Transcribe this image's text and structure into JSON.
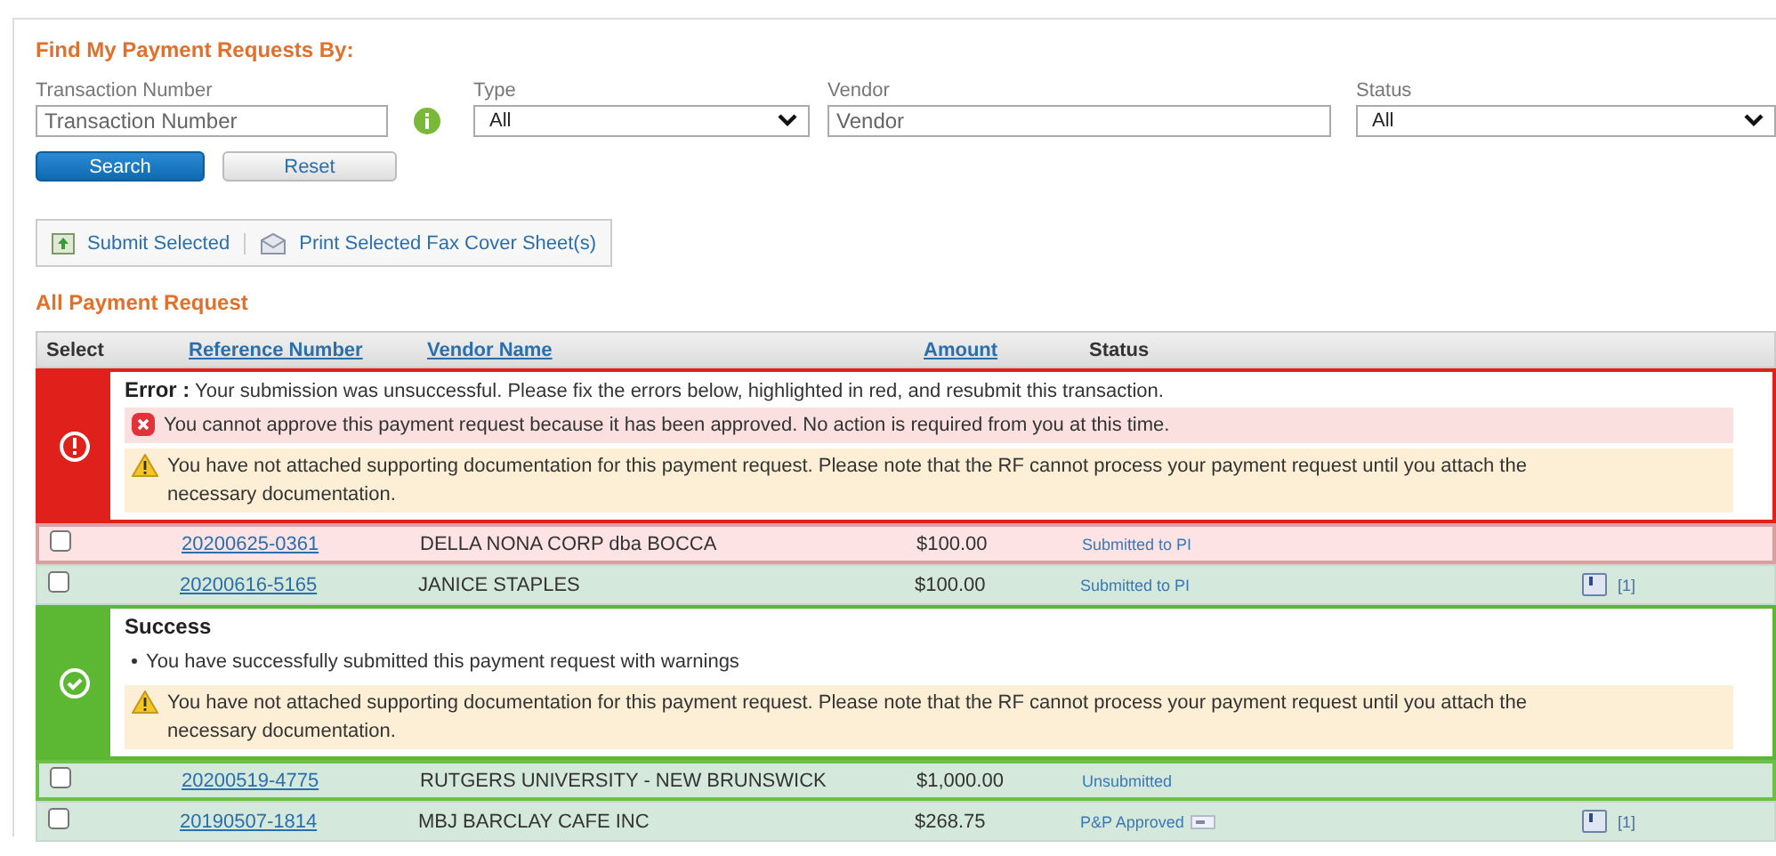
{
  "heading": "Find My Payment Requests By:",
  "filters": [
    {
      "kind": "text",
      "label": "Transaction Number",
      "placeholder": "Transaction Number",
      "info": true
    },
    {
      "kind": "select",
      "label": "Type",
      "value": "All"
    },
    {
      "kind": "text",
      "label": "Vendor",
      "placeholder": "Vendor",
      "info": false
    },
    {
      "kind": "select",
      "label": "Status",
      "value": "All"
    }
  ],
  "buttons": [
    {
      "label": "Search",
      "primary": true
    },
    {
      "label": "Reset",
      "primary": false
    }
  ],
  "toolbar": [
    {
      "kind": "submit",
      "label": "Submit Selected"
    },
    {
      "kind": "print",
      "label": "Print Selected Fax Cover Sheet(s)"
    }
  ],
  "section_title": "All Payment Request",
  "table": {
    "columns": [
      {
        "label": "Select",
        "link": false
      },
      {
        "label": "Reference Number",
        "link": true
      },
      {
        "label": "Vendor Name",
        "link": true
      },
      {
        "label": "Amount",
        "link": true
      },
      {
        "label": "Status",
        "link": false
      }
    ],
    "rows": [
      {
        "kind": "message",
        "failed": true,
        "title": "Error :",
        "text": "Your submission was unsuccessful. Please fix the errors below, highlighted in red, and resubmit this transaction.",
        "items": [
          {
            "kind": "error",
            "text": "You cannot approve this payment request because it has been approved. No action is required from you at this time."
          },
          {
            "kind": "warning",
            "text": "You have not attached supporting documentation for this payment request. Please note that the RF cannot process your payment request until you attach the necessary documentation."
          }
        ]
      },
      {
        "kind": "row",
        "failed": true,
        "outlined": true,
        "checked": false,
        "reference": "20200625-0361",
        "vendor": "DELLA NONA CORP dba BOCCA",
        "amount": "$100.00",
        "status": "Submitted to PI",
        "status_icon": false
      },
      {
        "kind": "row",
        "failed": false,
        "outlined": false,
        "checked": false,
        "reference": "20200616-5165",
        "vendor": "JANICE STAPLES",
        "amount": "$100.00",
        "status": "Submitted to PI",
        "status_icon": false,
        "attachments": "[1]"
      },
      {
        "kind": "message",
        "failed": false,
        "title": "Success",
        "items": [
          {
            "kind": "bullet",
            "text": "You have successfully submitted this payment request with warnings"
          },
          {
            "kind": "warning",
            "text": "You have not attached supporting documentation for this payment request. Please note that the RF cannot process your payment request until you attach the necessary documentation."
          }
        ]
      },
      {
        "kind": "row",
        "failed": false,
        "outlined": true,
        "checked": false,
        "reference": "20200519-4775",
        "vendor": "RUTGERS UNIVERSITY - NEW BRUNSWICK",
        "amount": "$1,000.00",
        "status": "Unsubmitted",
        "status_icon": false
      },
      {
        "kind": "row",
        "failed": false,
        "outlined": false,
        "checked": false,
        "reference": "20190507-1814",
        "vendor": "MBJ BARCLAY CAFE INC",
        "amount": "$268.75",
        "status": "P&P Approved",
        "status_icon": true,
        "attachments": "[1]"
      }
    ]
  }
}
